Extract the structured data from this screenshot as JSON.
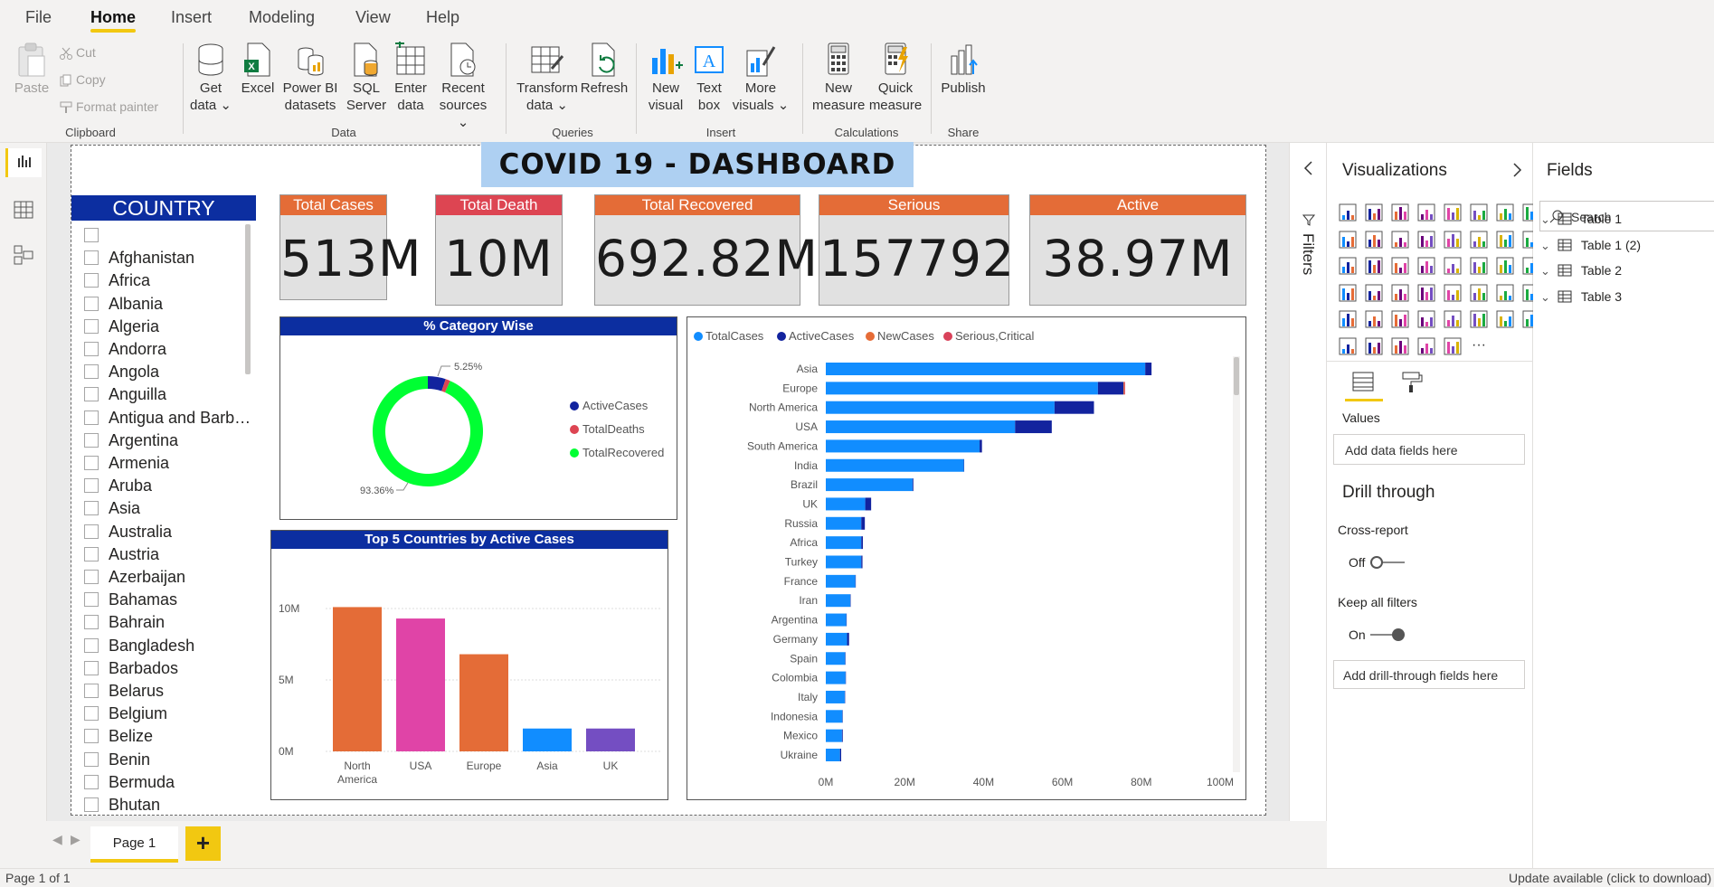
{
  "menu": {
    "file": "File",
    "home": "Home",
    "insert": "Insert",
    "modeling": "Modeling",
    "view": "View",
    "help": "Help"
  },
  "ribbon": {
    "clipboard": {
      "paste": "Paste",
      "cut": "Cut",
      "copy": "Copy",
      "format_painter": "Format painter",
      "label": "Clipboard"
    },
    "data": {
      "get_data": [
        "Get",
        "data"
      ],
      "excel": "Excel",
      "power_bi": [
        "Power BI",
        "datasets"
      ],
      "sql": [
        "SQL",
        "Server"
      ],
      "enter": [
        "Enter",
        "data"
      ],
      "recent": [
        "Recent",
        "sources"
      ],
      "label": "Data"
    },
    "queries": {
      "transform": [
        "Transform",
        "data"
      ],
      "refresh": "Refresh",
      "label": "Queries"
    },
    "insert": {
      "new_visual": [
        "New",
        "visual"
      ],
      "text_box": [
        "Text",
        "box"
      ],
      "more_visuals": [
        "More",
        "visuals"
      ],
      "label": "Insert"
    },
    "calculations": {
      "new_measure": [
        "New",
        "measure"
      ],
      "quick_measure": [
        "Quick",
        "measure"
      ],
      "label": "Calculations"
    },
    "share": {
      "publish": "Publish",
      "label": "Share"
    }
  },
  "dashboard": {
    "title": "COVID 19 - DASHBOARD",
    "slicer": {
      "header": "COUNTRY",
      "items": [
        "",
        "Afghanistan",
        "Africa",
        "Albania",
        "Algeria",
        "Andorra",
        "Angola",
        "Anguilla",
        "Antigua and Barb…",
        "Argentina",
        "Armenia",
        "Aruba",
        "Asia",
        "Australia",
        "Austria",
        "Azerbaijan",
        "Bahamas",
        "Bahrain",
        "Bangladesh",
        "Barbados",
        "Belarus",
        "Belgium",
        "Belize",
        "Benin",
        "Bermuda",
        "Bhutan"
      ]
    },
    "kpis": [
      {
        "label": "Total Cases",
        "value": "513M",
        "color": "#e46c37"
      },
      {
        "label": "Total Death",
        "value": "10M",
        "color": "#dd4552"
      },
      {
        "label": "Total Recovered",
        "value": "692.82M",
        "color": "#e46c37"
      },
      {
        "label": "Serious",
        "value": "157792",
        "color": "#e46c37"
      },
      {
        "label": "Active",
        "value": "38.97M",
        "color": "#e46c37"
      }
    ]
  },
  "chart_data": [
    {
      "type": "pie",
      "title": "% Category Wise",
      "categories": [
        "ActiveCases",
        "TotalDeaths",
        "TotalRecovered"
      ],
      "values": [
        5.25,
        1.39,
        93.36
      ],
      "colors": [
        "#12239e",
        "#dd4552",
        "#00ff33"
      ],
      "data_labels": [
        "5.25%",
        "93.36%"
      ],
      "donut": true,
      "legend_position": "right"
    },
    {
      "type": "bar",
      "title": "Top 5 Countries by Active Cases",
      "categories": [
        "North America",
        "USA",
        "Europe",
        "Asia",
        "UK"
      ],
      "values": [
        10.1,
        9.3,
        6.8,
        1.6,
        1.6
      ],
      "colors": [
        "#e46c37",
        "#e044a7",
        "#e46c37",
        "#118dff",
        "#744ec2"
      ],
      "ylim": [
        0,
        10
      ],
      "yticks": [
        "0M",
        "5M",
        "10M"
      ],
      "unit": "M"
    },
    {
      "type": "bar",
      "orientation": "horizontal",
      "stacked": true,
      "title": "",
      "legend": [
        "TotalCases",
        "ActiveCases",
        "NewCases",
        "Serious,Critical"
      ],
      "legend_colors": [
        "#118dff",
        "#12239e",
        "#e66c37",
        "#d9425a"
      ],
      "categories": [
        "Asia",
        "Europe",
        "North America",
        "USA",
        "South America",
        "India",
        "Brazil",
        "UK",
        "Russia",
        "Africa",
        "Turkey",
        "France",
        "Iran",
        "Argentina",
        "Germany",
        "Spain",
        "Colombia",
        "Italy",
        "Indonesia",
        "Mexico",
        "Ukraine"
      ],
      "series": [
        {
          "name": "TotalCases",
          "values": [
            81,
            69,
            58,
            48,
            39,
            35,
            22,
            10,
            9,
            9,
            9,
            7.5,
            6.2,
            5.2,
            5.4,
            4.9,
            5,
            4.8,
            4.2,
            4.1,
            3.6
          ]
        },
        {
          "name": "ActiveCases",
          "values": [
            1.6,
            6.5,
            10,
            9.3,
            0.6,
            0.1,
            0.2,
            1.5,
            0.9,
            0.4,
            0.3,
            0.1,
            0.1,
            0.1,
            0.5,
            0.1,
            0.1,
            0.1,
            0.1,
            0.2,
            0.3
          ]
        },
        {
          "name": "NewCases",
          "values": [
            0,
            0.2,
            0,
            0,
            0,
            0,
            0,
            0,
            0,
            0,
            0,
            0,
            0,
            0,
            0,
            0,
            0,
            0,
            0,
            0,
            0
          ]
        },
        {
          "name": "Serious,Critical",
          "values": [
            0,
            0.2,
            0,
            0,
            0,
            0,
            0,
            0,
            0,
            0,
            0,
            0,
            0,
            0,
            0,
            0,
            0,
            0,
            0,
            0,
            0
          ]
        }
      ],
      "xlim": [
        0,
        100
      ],
      "xticks": [
        "0M",
        "20M",
        "40M",
        "60M",
        "80M",
        "100M"
      ],
      "legend_position": "top-left"
    }
  ],
  "filters": {
    "label": "Filters"
  },
  "visualizations": {
    "title": "Visualizations",
    "values_label": "Values",
    "add_data_fields": "Add data fields here",
    "drill_through": "Drill through",
    "cross_report": "Cross-report",
    "cross_report_state": "Off",
    "keep_all_filters": "Keep all filters",
    "keep_filters_state": "On",
    "add_drill_through": "Add drill-through fields here"
  },
  "fields": {
    "title": "Fields",
    "search_placeholder": "Search",
    "tables": [
      "Table 1",
      "Table 1 (2)",
      "Table 2",
      "Table 3"
    ]
  },
  "pages": {
    "tab": "Page 1",
    "add": "+"
  },
  "status": {
    "left": "Page 1 of 1",
    "right": "Update available (click to download)"
  }
}
